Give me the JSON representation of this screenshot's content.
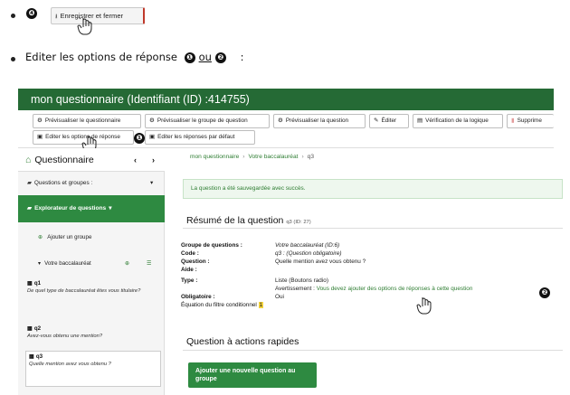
{
  "doc": {
    "step4_num": "❹",
    "save_close_label": "Enregistrer et fermer",
    "save_icon": "save-icon",
    "edit_options_text": "Editer les options de réponse",
    "num1": "❶",
    "or_text": "ou",
    "num2": "❷",
    "colon": ":"
  },
  "app": {
    "title": "mon questionnaire (Identifiant (ID) :414755)",
    "accent": "#256a35",
    "toolbar": {
      "preview_survey": "Prévisualiser le questionnaire",
      "preview_group": "Prévisualiser le groupe de question",
      "preview_question": "Prévisualiser la question",
      "edit": "Éditer",
      "logic_check": "Vérification de la logique",
      "delete": "Supprime",
      "edit_answer_options": "Editer les options de réponse",
      "edit_default_answers": "Editer les réponses par défaut"
    },
    "sidebar": {
      "header": "Questionnaire",
      "questions_groups": "Questions et groupes :",
      "explorer": "Explorateur de questions",
      "add_group": "Ajouter un groupe",
      "group_name": "Votre baccalauréat",
      "questions": [
        {
          "code": "q1",
          "text": "De quel type de baccalauréat êtes vous titulaire?"
        },
        {
          "code": "q2",
          "text": "Avez-vous obtenu une mention?"
        },
        {
          "code": "q3",
          "text": "Quelle mention avez vous obtenu ?"
        }
      ]
    },
    "breadcrumb": {
      "survey": "mon questionnaire",
      "group": "Votre baccalauréat",
      "question": "q3"
    },
    "alert": "La question a été sauvegardée avec succès.",
    "summary": {
      "title": "Résumé de la question",
      "qid": "q3 (ID: 27)",
      "rows": {
        "group_label": "Groupe de questions :",
        "group_value": "Votre baccalauréat (ID:6)",
        "code_label": "Code :",
        "code_value": "q3 : (Question obligatoire)",
        "question_label": "Question :",
        "question_value": "Quelle mention avez vous obtenu ?",
        "help_label": "Aide :",
        "type_label": "Type :",
        "type_value": "Liste (Boutons radio)",
        "warning_prefix": "Avertissement : ",
        "warning_link": "Vous devez ajouter des options de réponses à cette question",
        "mandatory_label": "Obligatoire :",
        "mandatory_value": "Oui",
        "filter_label": "Équation du filtre conditionnel",
        "filter_value": "1"
      }
    },
    "quick": {
      "title": "Question à actions rapides",
      "add_button": "Ajouter une nouvelle question au groupe"
    }
  }
}
